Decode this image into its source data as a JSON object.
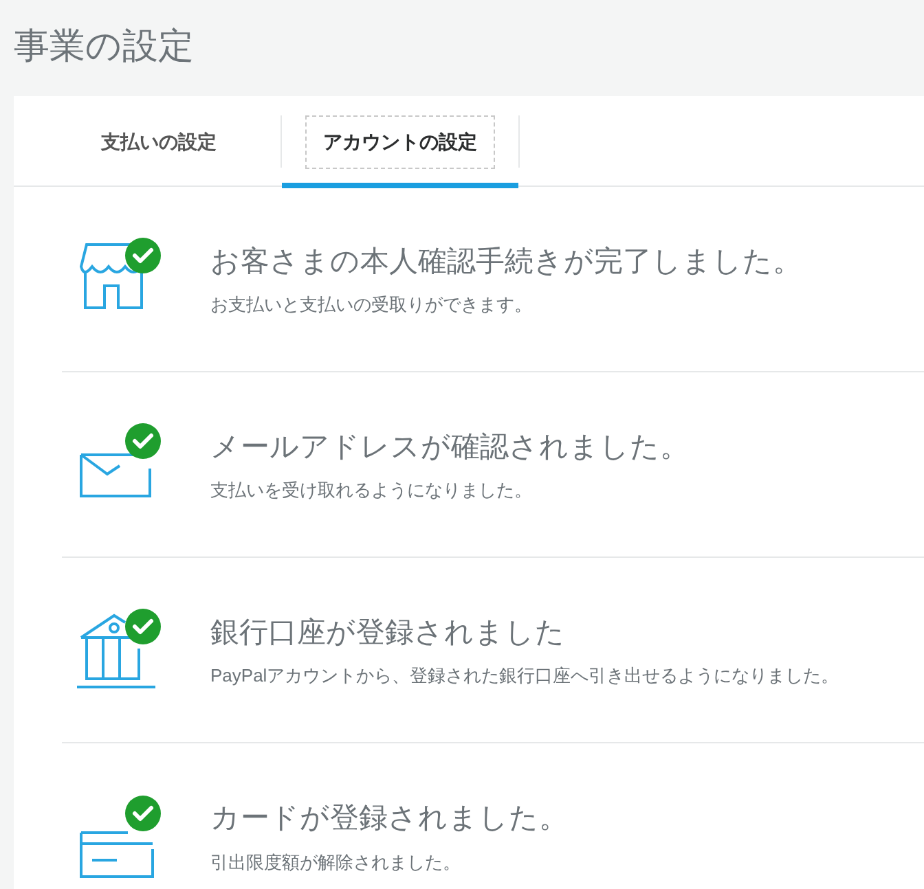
{
  "page_title": "事業の設定",
  "tabs": [
    {
      "label": "支払いの設定",
      "selected": false
    },
    {
      "label": "アカウントの設定",
      "selected": true
    }
  ],
  "items": [
    {
      "kind": "store",
      "verified": true,
      "title": "お客さまの本人確認手続きが完了しました。",
      "subtitle": "お支払いと支払いの受取りができます。"
    },
    {
      "kind": "mail",
      "verified": true,
      "title": "メールアドレスが確認されました。",
      "subtitle": "支払いを受け取れるようになりました。"
    },
    {
      "kind": "bank",
      "verified": true,
      "title": "銀行口座が登録されました",
      "subtitle": "PayPalアカウントから、登録された銀行口座へ引き出せるようになりました。"
    },
    {
      "kind": "card",
      "verified": true,
      "title": "カードが登録されました。",
      "subtitle": "引出限度額が解除されました。"
    }
  ]
}
